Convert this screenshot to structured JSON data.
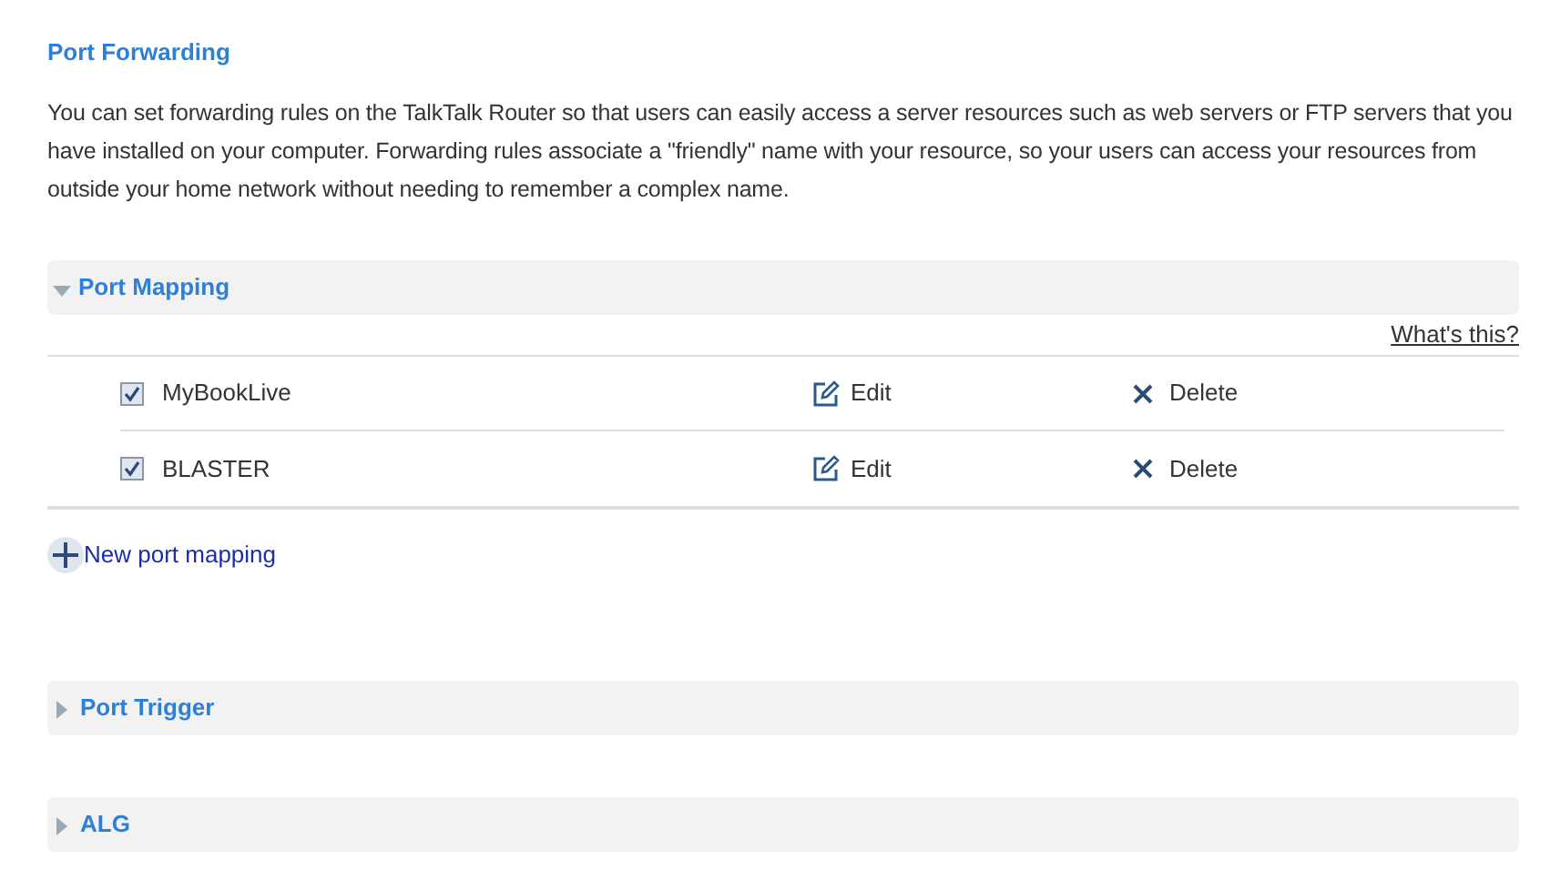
{
  "title": "Port Forwarding",
  "description": "You can set forwarding rules on the TalkTalk Router so that users can easily access a server resources such as web servers or FTP servers that you have installed on your computer. Forwarding rules associate a \"friendly\" name with your resource, so your users can access your resources from outside your home network without needing to remember a complex name.",
  "sections": [
    {
      "title": "Port Mapping",
      "expanded": true,
      "help_link": "What's this?",
      "rows": [
        {
          "name": "MyBookLive",
          "checked": true,
          "edit": "Edit",
          "delete": "Delete"
        },
        {
          "name": "BLASTER",
          "checked": true,
          "edit": "Edit",
          "delete": "Delete"
        }
      ],
      "add_label": "New port mapping"
    },
    {
      "title": "Port Trigger",
      "expanded": false
    },
    {
      "title": "ALG",
      "expanded": false
    }
  ]
}
